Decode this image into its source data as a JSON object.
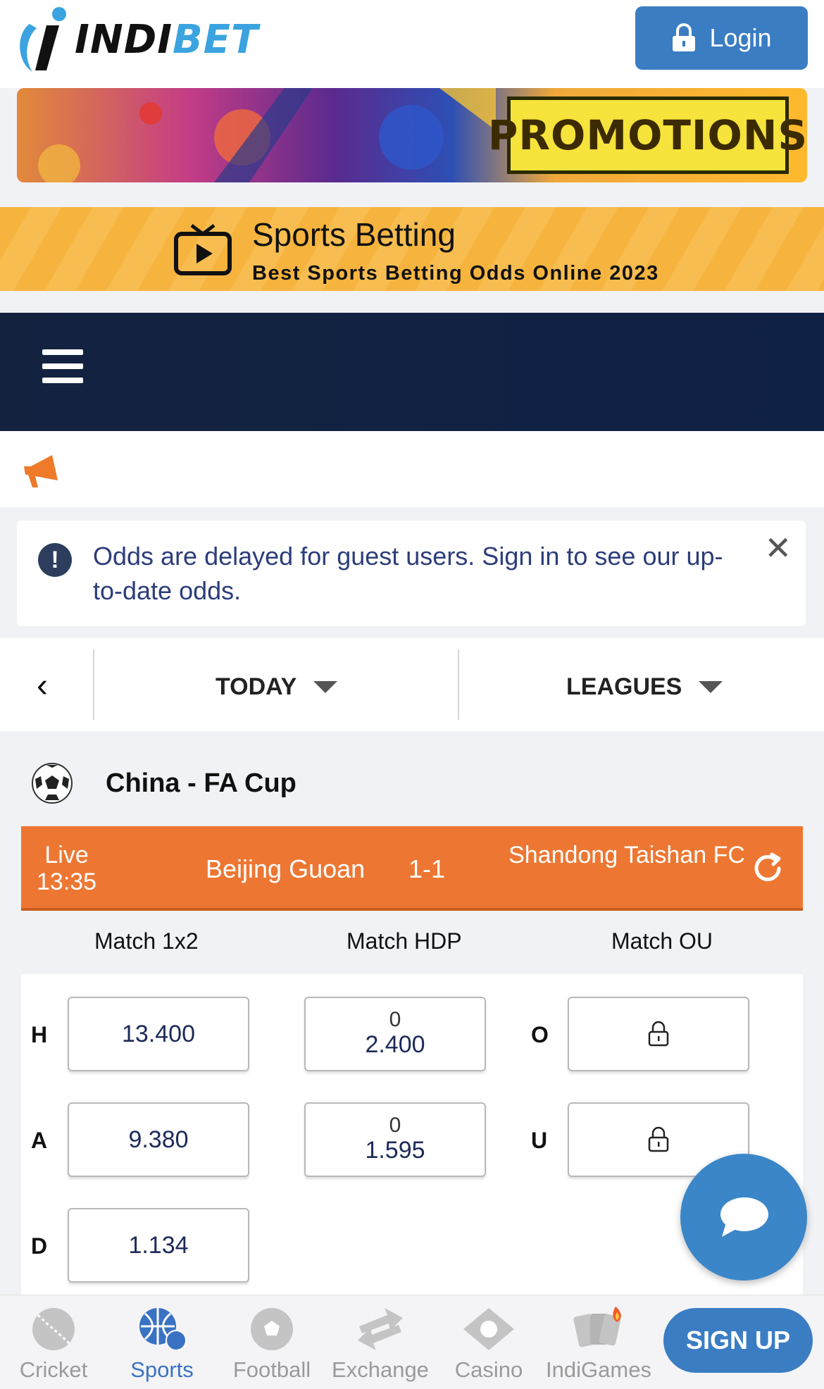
{
  "header": {
    "logo_main": "INDI",
    "logo_accent": "BET",
    "login_label": "Login"
  },
  "promo": {
    "label": "PROMOTIONS"
  },
  "sports_betting": {
    "title": "Sports Betting",
    "subtitle": "Best Sports Betting Odds Online 2023"
  },
  "alert": {
    "icon": "!",
    "text": "Odds are delayed for guest users. Sign in to see our up-to-date odds.",
    "close": "✕"
  },
  "filters": {
    "back": "‹",
    "date_label": "TODAY",
    "leagues_label": "LEAGUES"
  },
  "league": {
    "name": "China - FA Cup"
  },
  "match": {
    "status": "Live",
    "time": "13:35",
    "home": "Beijing Guoan",
    "score": "1-1",
    "away": "Shandong Taishan FC"
  },
  "markets": {
    "headers": [
      "Match 1x2",
      "Match HDP",
      "Match OU"
    ],
    "x12": [
      {
        "label": "H",
        "odd": "13.400"
      },
      {
        "label": "A",
        "odd": "9.380"
      },
      {
        "label": "D",
        "odd": "1.134"
      }
    ],
    "hdp": [
      {
        "line": "0",
        "odd": "2.400"
      },
      {
        "line": "0",
        "odd": "1.595"
      }
    ],
    "ou": [
      {
        "label": "O",
        "locked": true
      },
      {
        "label": "U",
        "locked": true
      }
    ]
  },
  "bottom_nav": {
    "items": [
      {
        "label": "Cricket",
        "icon": "cricket-ball-icon"
      },
      {
        "label": "Sports",
        "icon": "sports-balls-icon",
        "active": true
      },
      {
        "label": "Football",
        "icon": "football-icon"
      },
      {
        "label": "Exchange",
        "icon": "exchange-arrows-icon"
      },
      {
        "label": "Casino",
        "icon": "casino-chip-icon"
      },
      {
        "label": "IndiGames",
        "icon": "cards-fire-icon"
      }
    ],
    "signup_label": "SIGN UP"
  },
  "colors": {
    "brand_blue": "#3b7dc3",
    "live_orange": "#ed7732",
    "navbar_navy": "#13223f",
    "banner_yellow": "#f6b43e"
  }
}
